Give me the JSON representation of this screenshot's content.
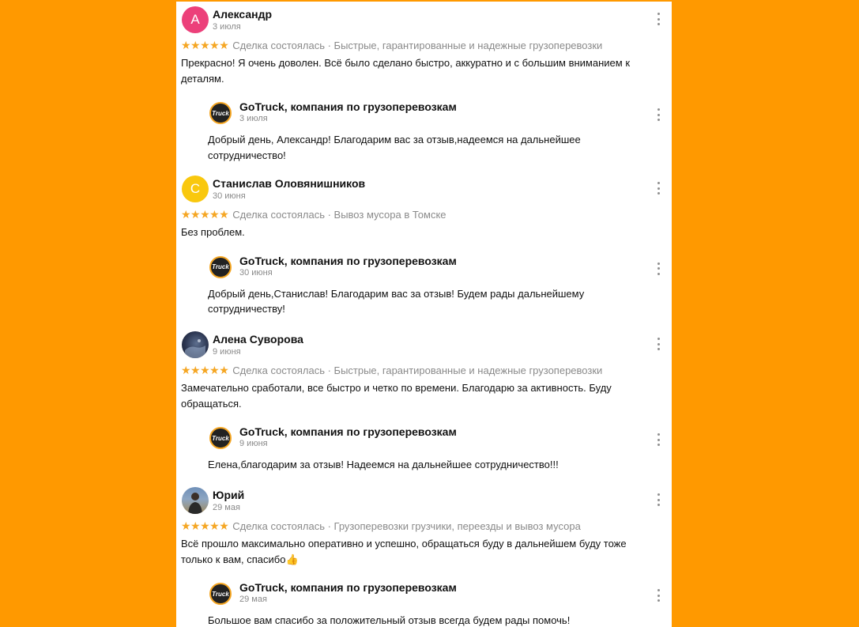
{
  "company": {
    "name": "GoTruck, компания по грузоперевозкам",
    "logo_text": "Truck"
  },
  "reviews": [
    {
      "author": "Александр",
      "avatar_letter": "А",
      "avatar_color": "#EC407A",
      "date": "3 июля",
      "rating": "★★★★★",
      "meta": "Сделка состоялась · Быстрые, гарантированные и надежные грузоперевозки",
      "text": "Прекрасно! Я очень доволен. Всё было сделано быстро, аккуратно и с большим вниманием к деталям.",
      "reply": {
        "date": "3 июля",
        "text": "Добрый день, Александр! Благодарим вас за отзыв,надеемся на дальнейшее сотрудничество!"
      }
    },
    {
      "author": "Станислав Оловянишников",
      "avatar_letter": "С",
      "avatar_color": "#F9C80E",
      "date": "30 июня",
      "rating": "★★★★★",
      "meta": "Сделка состоялась · Вывоз мусора в Томске",
      "text": "Без проблем.",
      "reply": {
        "date": "30 июня",
        "text": "Добрый день,Станислав! Благодарим вас за отзыв! Будем рады дальнейшему сотрудничеству!"
      }
    },
    {
      "author": "Алена Суворова",
      "date": "9 июня",
      "rating": "★★★★★",
      "meta": "Сделка состоялась · Быстрые, гарантированные и надежные грузоперевозки",
      "text": "Замечательно сработали, все быстро и четко по времени. Благодарю за активность. Буду обращаться.",
      "reply": {
        "date": "9 июня",
        "text": "Елена,благодарим за отзыв! Надеемся на дальнейшее сотрудничество!!!"
      }
    },
    {
      "author": "Юрий",
      "date": "29 мая",
      "rating": "★★★★★",
      "meta": "Сделка состоялась · Грузоперевозки грузчики, переезды и вывоз мусора",
      "text": "Всё прошло максимально оперативно и успешно, обращаться буду в дальнейшем буду тоже только к вам, спасибо👍",
      "reply": {
        "date": "29 мая",
        "text": "Большое вам спасибо за положительный отзыв всегда будем рады помочь!"
      }
    }
  ]
}
